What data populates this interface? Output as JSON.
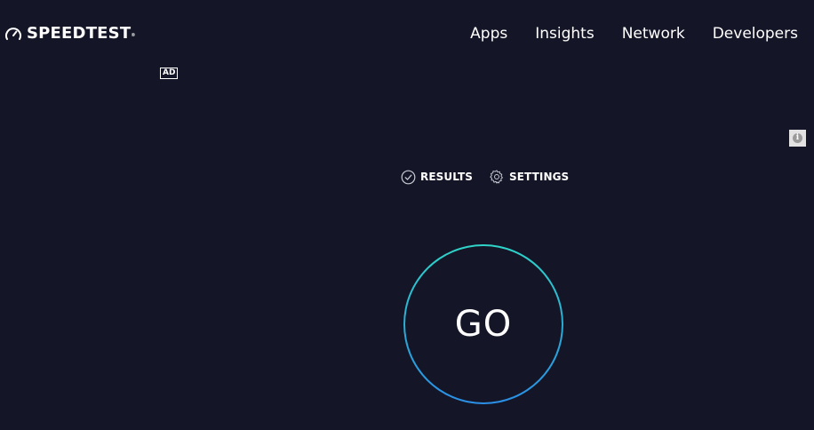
{
  "header": {
    "logo_text": "SPEEDTEST",
    "logo_mark": "®",
    "logo_icon": "speedometer-icon",
    "nav": [
      {
        "label": "Apps"
      },
      {
        "label": "Insights"
      },
      {
        "label": "Network"
      },
      {
        "label": "Developers"
      }
    ]
  },
  "ad": {
    "badge_label": "AD",
    "info_icon": "info-icon",
    "info_glyph": "i"
  },
  "controls": {
    "results_label": "RESULTS",
    "results_icon": "check-circle-icon",
    "settings_label": "SETTINGS",
    "settings_icon": "gear-icon"
  },
  "start": {
    "go_label": "GO"
  },
  "colors": {
    "background": "#141526",
    "ring_top": "#2fd4c8",
    "ring_bottom": "#2b8fe6",
    "text": "#ffffff"
  }
}
